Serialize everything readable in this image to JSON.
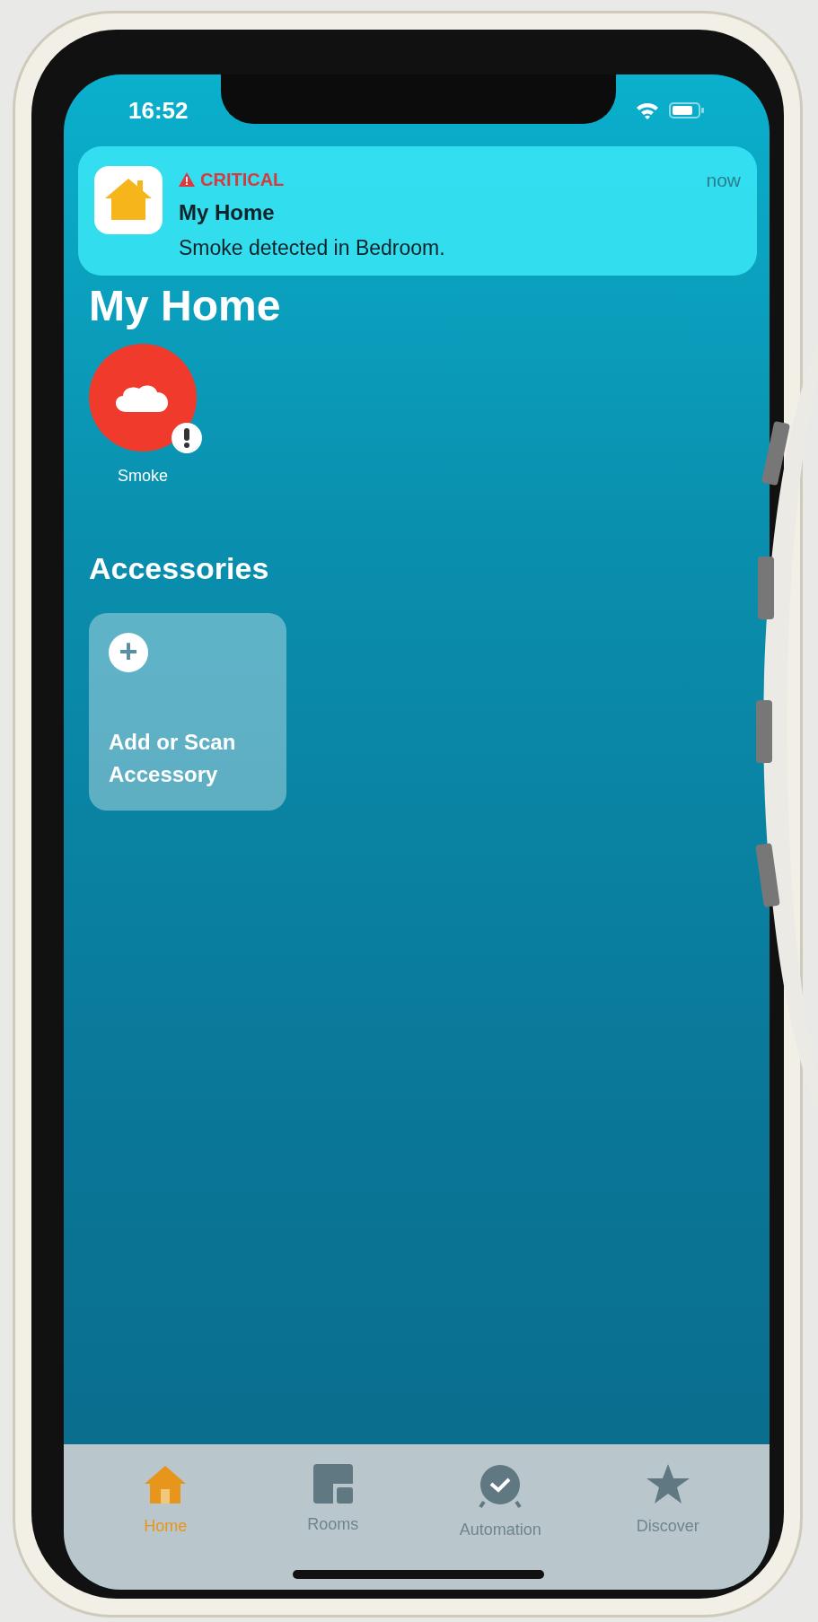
{
  "status_bar": {
    "time": "16:52"
  },
  "notification": {
    "tag": "CRITICAL",
    "app": "My Home",
    "message": "Smoke detected in Bedroom.",
    "time": "now"
  },
  "title": "My Home",
  "alerts": [
    {
      "label": "Smoke",
      "alert": true
    }
  ],
  "section_title": "Accessories",
  "add_tile": {
    "icon": "+",
    "label": "Add or Scan Accessory"
  },
  "tabs": [
    {
      "label": "Home",
      "selected": true
    },
    {
      "label": "Rooms",
      "selected": false
    },
    {
      "label": "Automation",
      "selected": false
    },
    {
      "label": "Discover",
      "selected": false
    }
  ]
}
